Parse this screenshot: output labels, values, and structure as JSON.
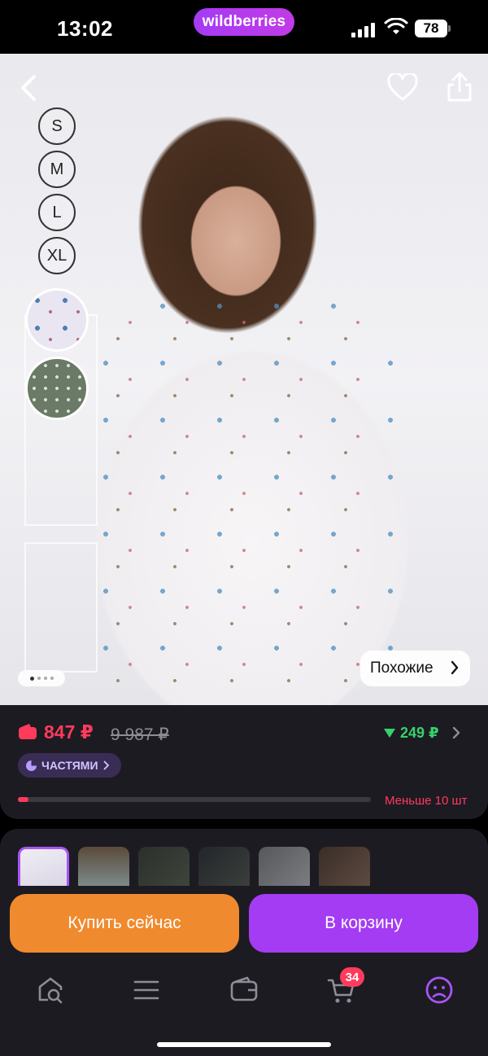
{
  "status_bar": {
    "time": "13:02",
    "brand": "wildberries",
    "battery": "78"
  },
  "product": {
    "sizes": [
      "S",
      "M",
      "L",
      "XL"
    ],
    "colors": [
      "white-floral",
      "green-floral"
    ],
    "similar_label": "Похожие",
    "gallery_pages": 4,
    "gallery_active": 1
  },
  "price": {
    "current": "847 ₽",
    "old": "9 987 ₽",
    "cashback": "249 ₽",
    "installment": "ЧАСТЯМИ",
    "stock_text": "Меньше 10 шт",
    "stock_fraction": 0.03
  },
  "actions": {
    "buy_now": "Купить сейчас",
    "add_to_cart": "В корзину"
  },
  "tabbar": {
    "cart_count": "34",
    "items": [
      "home-search-icon",
      "menu-icon",
      "wallet-icon",
      "cart-icon",
      "profile-icon"
    ]
  },
  "colors": {
    "accent_purple": "#a33cf2",
    "accent_orange": "#f08a2e",
    "price_red": "#ff3b5c",
    "cashback_green": "#37d16b",
    "surface": "#1c1b22"
  }
}
